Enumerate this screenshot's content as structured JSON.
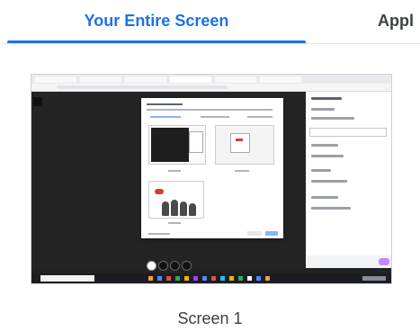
{
  "tabs": {
    "active_label": "Your Entire Screen",
    "inactive_label": "Appl"
  },
  "screens": [
    {
      "label": "Screen 1"
    }
  ],
  "colors": {
    "accent": "#1a73e8",
    "tab_text": "#3c4043"
  }
}
